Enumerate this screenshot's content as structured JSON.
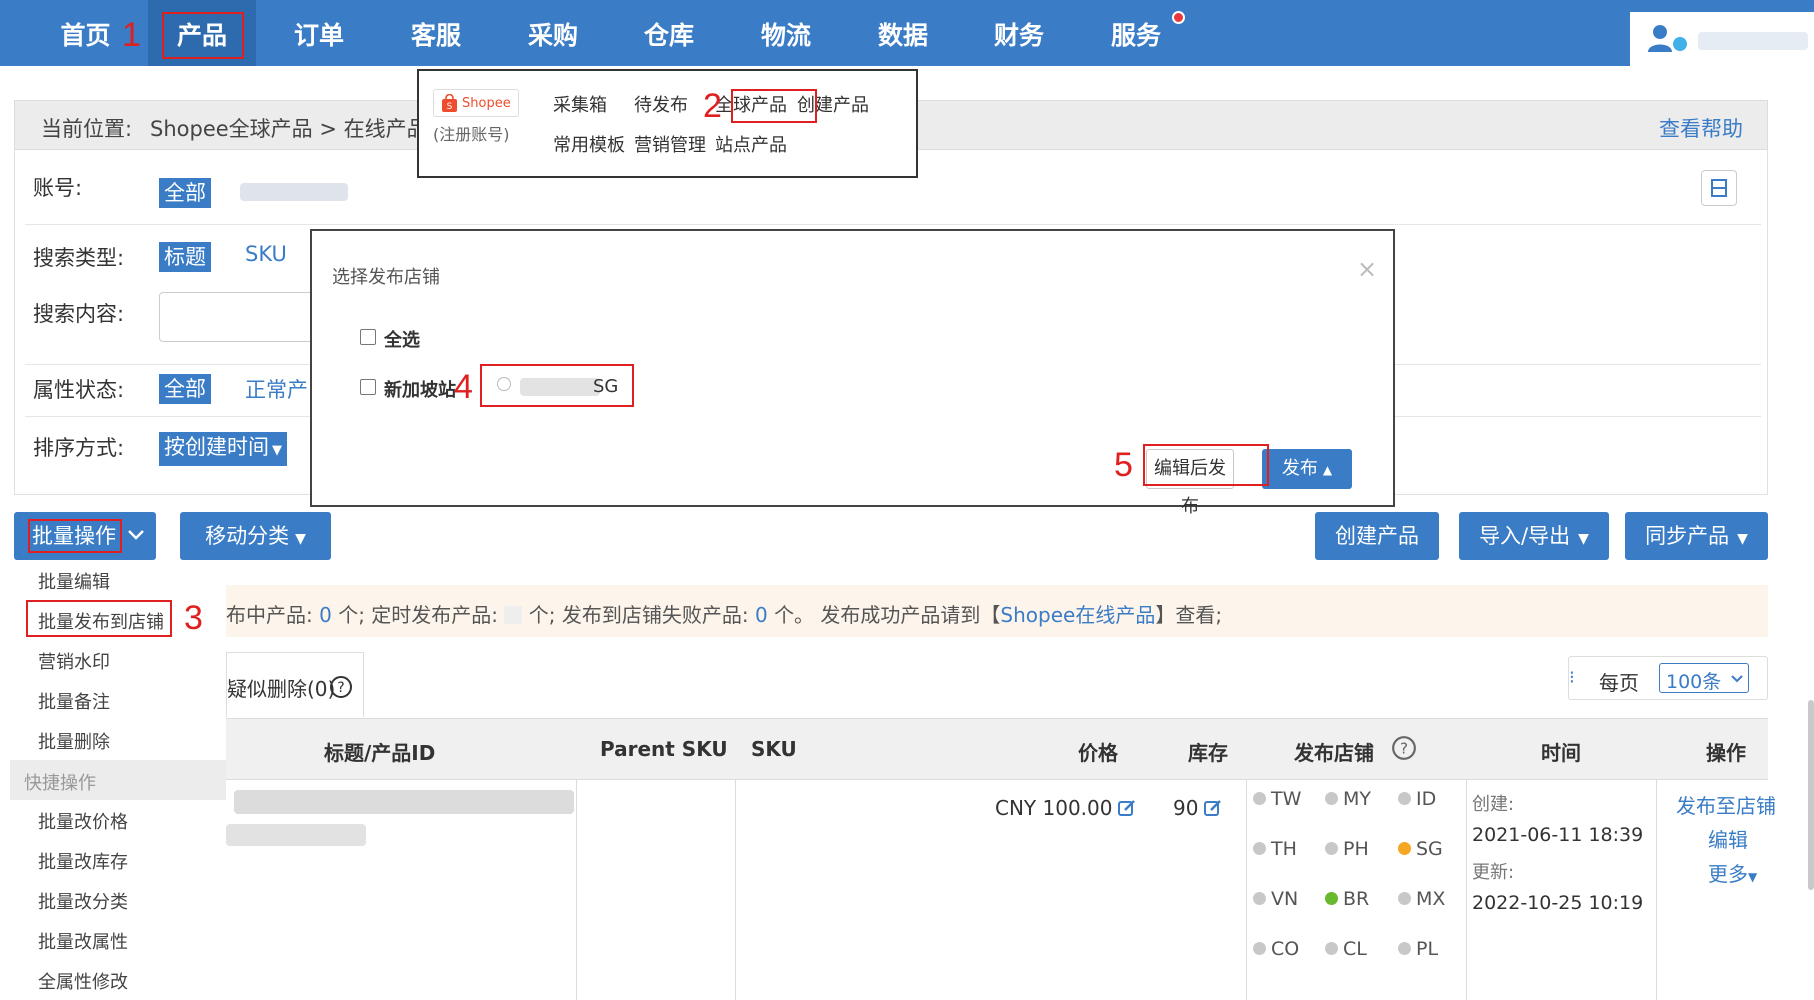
{
  "nav": {
    "items": [
      {
        "label": "首页"
      },
      {
        "label": "产品"
      },
      {
        "label": "订单"
      },
      {
        "label": "客服"
      },
      {
        "label": "采购"
      },
      {
        "label": "仓库"
      },
      {
        "label": "物流"
      },
      {
        "label": "数据"
      },
      {
        "label": "财务"
      },
      {
        "label": "服务"
      }
    ],
    "active_index": 1
  },
  "annotations": {
    "step1": "1",
    "step2": "2",
    "step3": "3",
    "step4": "4",
    "step5": "5"
  },
  "product_menu": {
    "shopee_logo": "Shopee",
    "shopee_note": "(注册账号)",
    "items": [
      "采集箱",
      "待发布",
      "全球产品",
      "创建产品",
      "常用模板",
      "营销管理",
      "站点产品"
    ]
  },
  "breadcrumb": {
    "prefix": "当前位置:",
    "path": "Shopee全球产品 > 在线产品",
    "help": "查看帮助"
  },
  "filters": {
    "account_label": "账号:",
    "account_all": "全部",
    "search_type_label": "搜索类型:",
    "search_type_options": [
      "标题",
      "SKU"
    ],
    "search_content_label": "搜索内容:",
    "attr_status_label": "属性状态:",
    "attr_status_all": "全部",
    "attr_status_normal": "正常产",
    "sort_label": "排序方式:",
    "sort_value": "按创建时间"
  },
  "modal": {
    "title": "选择发布店铺",
    "close": "×",
    "select_all": "全选",
    "site_label": "新加坡站",
    "store_suffix": "SG",
    "edit_publish_button": "编辑后发布",
    "publish_button": "发布"
  },
  "toolbar": {
    "batch_ops": "批量操作",
    "move_category": "移动分类",
    "create_product": "创建产品",
    "import_export": "导入/导出",
    "sync_products": "同步产品"
  },
  "batch_menu": {
    "items": [
      "批量编辑",
      "批量发布到店铺",
      "营销水印",
      "批量备注",
      "批量删除"
    ],
    "quick_header": "快捷操作",
    "quick_items": [
      "批量改价格",
      "批量改库存",
      "批量改分类",
      "批量改属性",
      "全属性修改"
    ]
  },
  "notice": {
    "t1": "布中产品:",
    "v1": "0",
    "t2": "个;  定时发布产品:",
    "t3": "个;  发布到店铺失败产品:",
    "v3": "0",
    "t4": "个。 发布成功产品请到【",
    "link": "Shopee在线产品",
    "t5": "】查看;"
  },
  "tabs": {
    "deleted": "疑似删除(0)"
  },
  "pagination": {
    "per_page_label": "每页",
    "per_page_value": "100条"
  },
  "table": {
    "headers": [
      "标题/产品ID",
      "Parent SKU",
      "SKU",
      "价格",
      "库存",
      "发布店铺",
      "时间",
      "操作"
    ],
    "row": {
      "price": "CNY  100.00",
      "stock": "90",
      "stores": [
        {
          "code": "TW",
          "color": "#c8c8c8"
        },
        {
          "code": "MY",
          "color": "#c8c8c8"
        },
        {
          "code": "ID",
          "color": "#c8c8c8"
        },
        {
          "code": "TH",
          "color": "#c8c8c8"
        },
        {
          "code": "PH",
          "color": "#c8c8c8"
        },
        {
          "code": "SG",
          "color": "#f5a623"
        },
        {
          "code": "VN",
          "color": "#c8c8c8"
        },
        {
          "code": "BR",
          "color": "#6ab82f"
        },
        {
          "code": "MX",
          "color": "#c8c8c8"
        },
        {
          "code": "CO",
          "color": "#c8c8c8"
        },
        {
          "code": "CL",
          "color": "#c8c8c8"
        },
        {
          "code": "PL",
          "color": "#c8c8c8"
        }
      ],
      "created_label": "创建:",
      "created": "2021-06-11 18:39",
      "updated_label": "更新:",
      "updated": "2022-10-25 10:19",
      "op_publish": "发布至店铺",
      "op_edit": "编辑",
      "op_more": "更多"
    }
  },
  "colors": {
    "primary": "#3a7cc6",
    "annotation_red": "#e02020",
    "notice_bg": "#fdf5eb",
    "store_active_orange": "#f5a623",
    "store_active_green": "#6ab82f"
  }
}
